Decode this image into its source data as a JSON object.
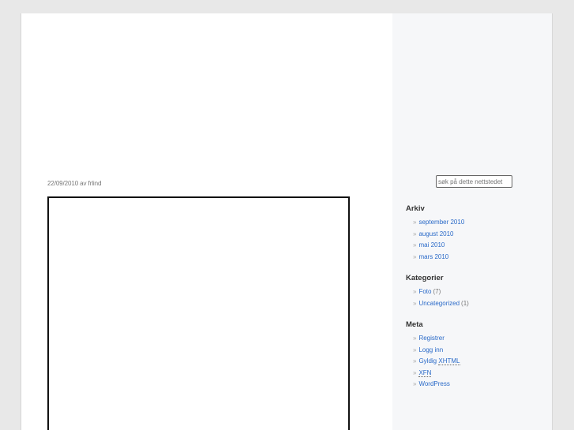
{
  "post": {
    "date": "22/09/2010",
    "by": "av",
    "author": "frlind"
  },
  "sidebar": {
    "search_placeholder": "søk på dette nettstedet",
    "archive": {
      "title": "Arkiv",
      "items": [
        "september 2010",
        "august 2010",
        "mai 2010",
        "mars 2010"
      ]
    },
    "categories": {
      "title": "Kategorier",
      "items": [
        {
          "label": "Foto",
          "count": "(7)"
        },
        {
          "label": "Uncategorized",
          "count": "(1)"
        }
      ]
    },
    "meta": {
      "title": "Meta",
      "items": [
        {
          "label": "Registrer"
        },
        {
          "label": "Logg inn"
        },
        {
          "label": "Gyldig",
          "abbr": "XHTML"
        },
        {
          "label": "XFN"
        },
        {
          "label": "WordPress"
        }
      ]
    }
  },
  "colors": {
    "link": "#2a6ac8",
    "sidebar_bg": "#f6f7f9",
    "page_bg": "#e8e8e8"
  }
}
